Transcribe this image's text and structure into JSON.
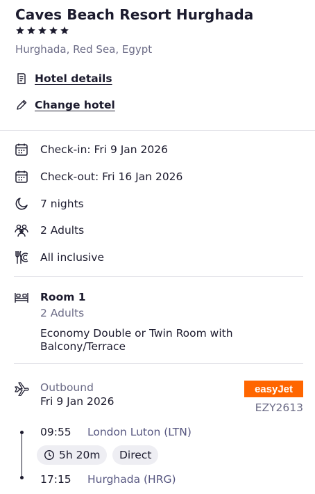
{
  "hotel": {
    "name": "Caves Beach Resort Hurghada",
    "stars": 5,
    "location": "Hurghada, Red Sea, Egypt",
    "details_link": "Hotel details",
    "change_link": "Change hotel"
  },
  "stay": {
    "checkin": "Check-in: Fri 9 Jan 2026",
    "checkout": "Check-out: Fri 16 Jan 2026",
    "nights": "7 nights",
    "guests": "2 Adults",
    "board": "All inclusive"
  },
  "room": {
    "title": "Room 1",
    "guests": "2 Adults",
    "type": "Economy Double or Twin Room with Balcony/Terrace"
  },
  "flight": {
    "label": "Outbound",
    "date": "Fri 9 Jan 2026",
    "airline": "easyJet",
    "airline_color": "#ff6600",
    "number": "EZY2613",
    "departure": {
      "time": "09:55",
      "place": "London Luton (LTN)"
    },
    "duration": "5h 20m",
    "stops": "Direct",
    "arrival": {
      "time": "17:15",
      "place": "Hurghada (HRG)"
    }
  }
}
